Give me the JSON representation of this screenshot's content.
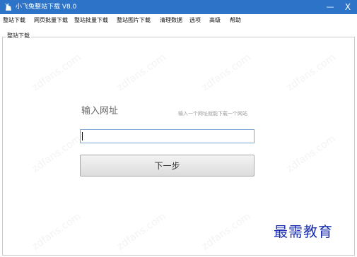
{
  "window": {
    "title": "小飞兔整站下载 V8.0",
    "minimize_glyph": "—",
    "close_glyph": "X"
  },
  "menu": {
    "items": [
      "整站下载",
      "网页批量下载",
      "整站批量下载",
      "整站图片下载",
      "清理数据",
      "选项",
      "高级",
      "帮助"
    ]
  },
  "panel": {
    "group_label": "整站下载",
    "heading": "输入网址",
    "hint": "输入一个网址就能下载一个网站",
    "url_value": "",
    "next_button": "下一步"
  },
  "watermark": {
    "logo_text": "最需教育",
    "logo_color": "#1a2fb0"
  },
  "colors": {
    "titlebar": "#2d73c7",
    "input_border": "#7aa7d6"
  },
  "icons": [
    "rabbit-app-icon",
    "minimize-icon",
    "close-icon"
  ]
}
